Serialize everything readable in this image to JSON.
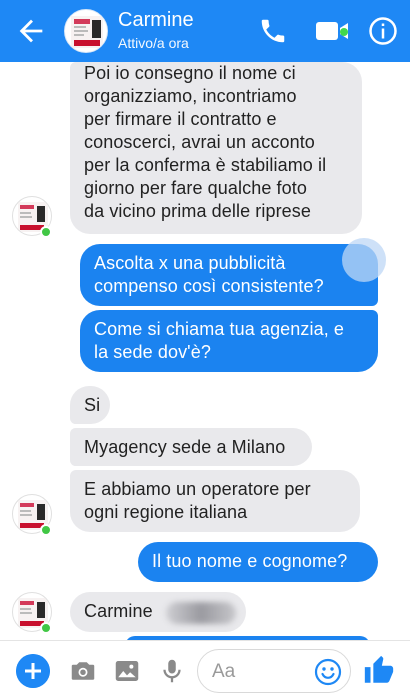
{
  "header": {
    "contact_name": "Carmine",
    "status": "Attivo/a ora",
    "accent_color": "#1e88f5",
    "icons": [
      "back-arrow-icon",
      "phone-icon",
      "video-camera-icon",
      "info-icon"
    ]
  },
  "messages": [
    {
      "sender": "contact",
      "text": "Poi io consegno il nome ci\norganizziamo, incontriamo\nper firmare il contratto e\nconoscerci, avrai un acconto\nper la conferma è stabiliamo il\ngiorno per fare qualche foto\nda vicino prima delle riprese"
    },
    {
      "sender": "me",
      "text": "Ascolta x una pubblicità\ncompenso così consistente?"
    },
    {
      "sender": "me",
      "text": "Come si chiama tua agenzia, e\nla sede dov'è?"
    },
    {
      "sender": "contact",
      "text": "Si"
    },
    {
      "sender": "contact",
      "text": "Myagency sede a Milano"
    },
    {
      "sender": "contact",
      "text": "E abbiamo un operatore per\nogni regione italiana"
    },
    {
      "sender": "me",
      "text": "Il tuo nome e cognome?"
    },
    {
      "sender": "contact",
      "text": "Carmine"
    }
  ],
  "composer": {
    "placeholder": "Aa",
    "icons": [
      "plus-icon",
      "camera-icon",
      "image-icon",
      "microphone-icon",
      "emoji-icon",
      "thumbs-up-icon"
    ]
  }
}
